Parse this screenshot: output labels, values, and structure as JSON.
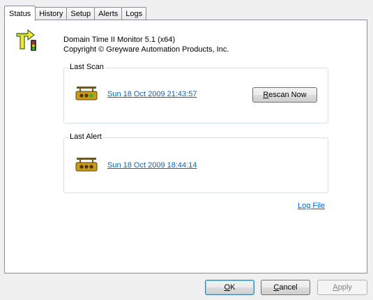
{
  "tabs": [
    "Status",
    "History",
    "Setup",
    "Alerts",
    "Logs"
  ],
  "app": {
    "title": "Domain Time II Monitor 5.1 (x64)",
    "copyright": "Copyright © Greyware Automation Products, Inc."
  },
  "last_scan": {
    "label": "Last Scan",
    "timestamp": "Sun 18 Oct 2009 21:43:57",
    "rescan_prefix": "R",
    "rescan_rest": "escan Now"
  },
  "last_alert": {
    "label": "Last Alert",
    "timestamp": "Sun 18 Oct 2009 18:44:14"
  },
  "log_file": {
    "prefix": "L",
    "rest": "og File"
  },
  "buttons": {
    "ok_prefix": "O",
    "ok_rest": "K",
    "cancel_prefix": "C",
    "cancel_rest": "ancel",
    "apply_prefix": "A",
    "apply_rest": "pply"
  },
  "colors": {
    "link": "#0066cc",
    "green_light": "#22c01a",
    "yellow_light": "#f4d000",
    "red_light": "#d42020"
  }
}
